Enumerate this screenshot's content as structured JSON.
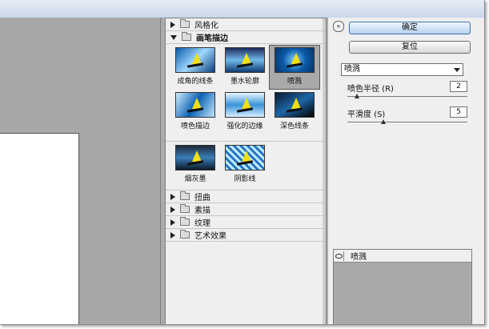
{
  "categories_top": [
    {
      "label": "风格化"
    }
  ],
  "open_category": {
    "label": "画笔描边"
  },
  "filters": [
    {
      "label": "成角的线条"
    },
    {
      "label": "墨水轮廓"
    },
    {
      "label": "喷溅"
    },
    {
      "label": "喷色描边"
    },
    {
      "label": "强化的边缘"
    },
    {
      "label": "深色线条"
    },
    {
      "label": "烟灰墨"
    },
    {
      "label": "阴影线"
    }
  ],
  "categories_bottom": [
    {
      "label": "扭曲"
    },
    {
      "label": "素描"
    },
    {
      "label": "纹理"
    },
    {
      "label": "艺术效果"
    }
  ],
  "buttons": {
    "ok": "确定",
    "reset": "复位",
    "collapse_symbol": "»"
  },
  "filter_select": {
    "value": "喷溅"
  },
  "params": {
    "spray_radius": {
      "label": "喷色半径 (R)",
      "value": "2",
      "level": 0.08
    },
    "smoothness": {
      "label": "平滑度 (S)",
      "value": "5",
      "level": 0.3
    }
  },
  "layers": [
    {
      "label": "喷溅"
    }
  ],
  "colors": {
    "selected_bg": "#a9a9a9",
    "sail": "#f2df12"
  }
}
